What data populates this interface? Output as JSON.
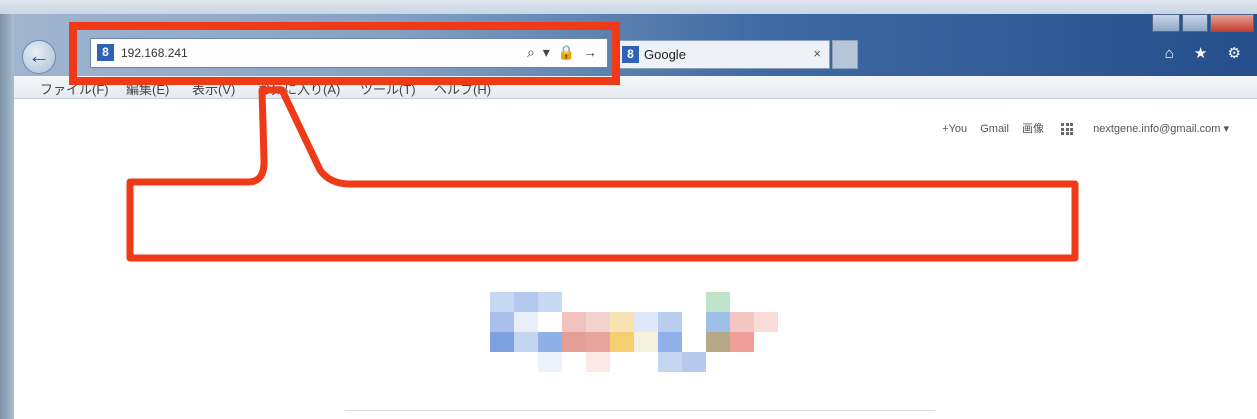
{
  "browser": {
    "back_glyph": "←",
    "address": "192.168.241",
    "address_tools": "⌕ ▾ 🔒 →",
    "tab": {
      "title": "Google",
      "close": "×"
    },
    "right_icons": "⌂ ★ ⚙"
  },
  "menubar": [
    "ファイル(F)",
    "編集(E)",
    "表示(V)",
    "お気に入り(A)",
    "ツール(T)",
    "ヘルプ(H)"
  ],
  "google_bar": {
    "plus": "+You",
    "gmail": "Gmail",
    "images": "画像",
    "account": "nextgene.info@gmail.com ▾"
  },
  "annotation": {
    "color": "#f03a17",
    "text": ""
  },
  "logo": {
    "alt": "Google (blurred)"
  }
}
